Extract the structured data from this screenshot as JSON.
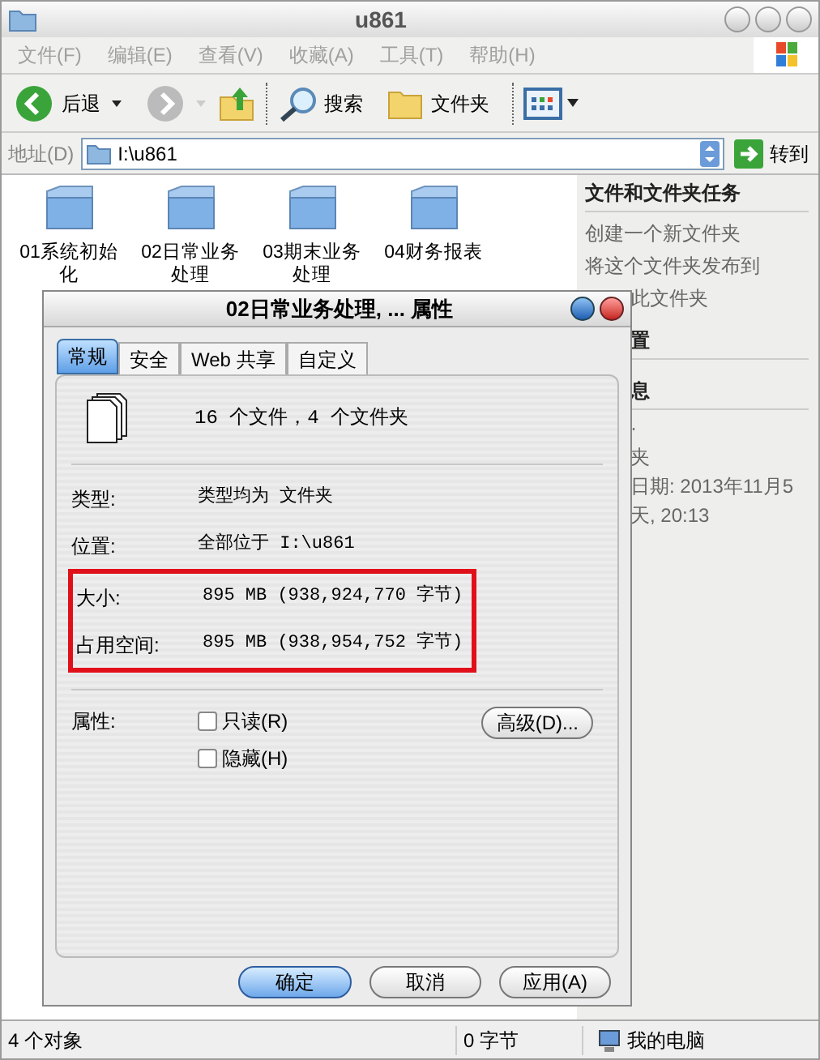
{
  "window": {
    "title": "u861"
  },
  "menu": [
    {
      "label": "文件(F)",
      "disabled": true
    },
    {
      "label": "编辑(E)",
      "disabled": true
    },
    {
      "label": "查看(V)",
      "disabled": true
    },
    {
      "label": "收藏(A)",
      "disabled": true
    },
    {
      "label": "工具(T)",
      "disabled": true
    },
    {
      "label": "帮助(H)",
      "disabled": true
    }
  ],
  "toolbar": {
    "back": "后退",
    "search": "搜索",
    "folders": "文件夹"
  },
  "address": {
    "label": "地址(D)",
    "value": "I:\\u861",
    "go": "转到"
  },
  "folders": [
    {
      "name": "01系统初始化"
    },
    {
      "name": "02日常业务处理"
    },
    {
      "name": "03期末业务处理"
    },
    {
      "name": "04财务报表"
    }
  ],
  "task_pane": [
    {
      "kind": "heading",
      "text": "文件和文件夹任务",
      "partial": false
    },
    {
      "kind": "link",
      "text": "创建一个新文件夹",
      "partial": false
    },
    {
      "kind": "link",
      "text": "将这个文件夹发布到",
      "partial": false
    },
    {
      "kind": "link",
      "text": "此文件夹",
      "partial": true
    },
    {
      "kind": "heading",
      "text": "置",
      "partial": true
    },
    {
      "kind": "heading",
      "text": "息",
      "partial": true
    },
    {
      "kind": "detail",
      "text": "·",
      "partial": true
    },
    {
      "kind": "detail",
      "text": "夹",
      "partial": true
    },
    {
      "kind": "detail",
      "text": "日期: 2013年11月5",
      "partial": true
    },
    {
      "kind": "detail",
      "text": "天, 20:13",
      "partial": true
    }
  ],
  "dialog": {
    "title": "02日常业务处理, ... 属性",
    "tabs": [
      {
        "label": "常规",
        "selected": true
      },
      {
        "label": "安全",
        "selected": false
      },
      {
        "label": "Web 共享",
        "selected": false
      },
      {
        "label": "自定义",
        "selected": false
      }
    ],
    "summary": "16 个文件，4 个文件夹",
    "fields": [
      {
        "label": "类型:",
        "value": "类型均为 文件夹",
        "highlighted": false
      },
      {
        "label": "位置:",
        "value": "全部位于 I:\\u861",
        "highlighted": false
      },
      {
        "label": "大小:",
        "value": "895 MB (938,924,770 字节)",
        "highlighted": true
      },
      {
        "label": "占用空间:",
        "value": "895 MB (938,954,752 字节)",
        "highlighted": true
      }
    ],
    "attributes_label": "属性:",
    "attributes": [
      {
        "label": "只读(R)",
        "checked": false
      },
      {
        "label": "隐藏(H)",
        "checked": false
      }
    ],
    "advanced_button": "高级(D)...",
    "buttons": [
      {
        "label": "确定",
        "default": true
      },
      {
        "label": "取消",
        "default": false
      },
      {
        "label": "应用(A)",
        "default": false
      }
    ]
  },
  "status_bar": {
    "objects": "4 个对象",
    "size": "0 字节",
    "location": "我的电脑"
  }
}
